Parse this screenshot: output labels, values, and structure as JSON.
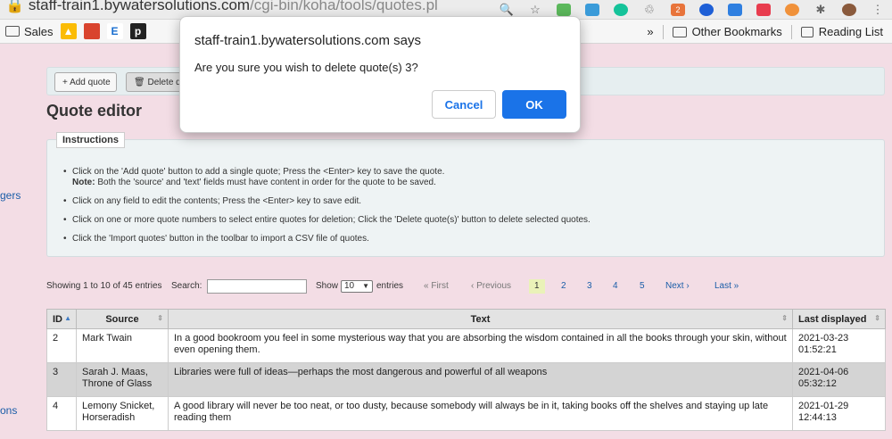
{
  "browser": {
    "url_host": "staff-train1.bywatersolutions.com",
    "url_path": "/cgi-bin/koha/tools/quotes.pl",
    "extension_badge": "2",
    "bookmarks": {
      "sales": "Sales",
      "fav_e": "E",
      "fav_p": "p",
      "chevron": "»",
      "other": "Other Bookmarks",
      "reading": "Reading List"
    }
  },
  "sidebar": {
    "frag1": "gers",
    "frag2": "ons"
  },
  "toolbar": {
    "add_label": "+ Add quote",
    "delete_label": "🗑 Delete quote(s)"
  },
  "page": {
    "title": "Quote editor"
  },
  "instructions": {
    "legend": "Instructions",
    "items": [
      "Click on the 'Add quote' button to add a single quote; Press the <Enter> key to save the quote.",
      "Click on any field to edit the contents; Press the <Enter> key to save edit.",
      "Click on one or more quote numbers to select entire quotes for deletion; Click the 'Delete quote(s)' button to delete selected quotes.",
      "Click the 'Import quotes' button in the toolbar to import a CSV file of quotes."
    ],
    "note_label": "Note:",
    "note_text": " Both the 'source' and 'text' fields must have content in order for the quote to be saved."
  },
  "table_controls": {
    "info": "Showing 1 to 10 of 45 entries",
    "search_label": "Search:",
    "search_value": "",
    "show_label": "Show",
    "show_value": "10",
    "entries_label": "entries",
    "first": "« First",
    "previous": "‹ Previous",
    "pages": [
      "1",
      "2",
      "3",
      "4",
      "5"
    ],
    "next": "Next ›",
    "last": "Last »"
  },
  "table": {
    "headers": [
      "ID",
      "Source",
      "Text",
      "Last displayed"
    ],
    "rows": [
      {
        "id": "2",
        "source": "Mark Twain",
        "text": "In a good bookroom you feel in some mysterious way that you are absorbing the wisdom contained in all the books through your skin, without even opening them.",
        "last_displayed": "2021-03-23 01:52:21"
      },
      {
        "id": "3",
        "source": "Sarah J. Maas, Throne of Glass",
        "text": "Libraries were full of ideas—perhaps the most dangerous and powerful of all weapons",
        "last_displayed": "2021-04-06 05:32:12"
      },
      {
        "id": "4",
        "source": "Lemony Snicket, Horseradish",
        "text": "A good library will never be too neat, or too dusty, because somebody will always be in it, taking books off the shelves and staying up late reading them",
        "last_displayed": "2021-01-29 12:44:13"
      }
    ]
  },
  "dialog": {
    "title": "staff-train1.bywatersolutions.com says",
    "message": "Are you sure you wish to delete quote(s) 3?",
    "cancel": "Cancel",
    "ok": "OK"
  },
  "colors": {
    "accent": "#1a73e8",
    "link": "#1a5da8",
    "page_bg": "#f3dde5"
  }
}
